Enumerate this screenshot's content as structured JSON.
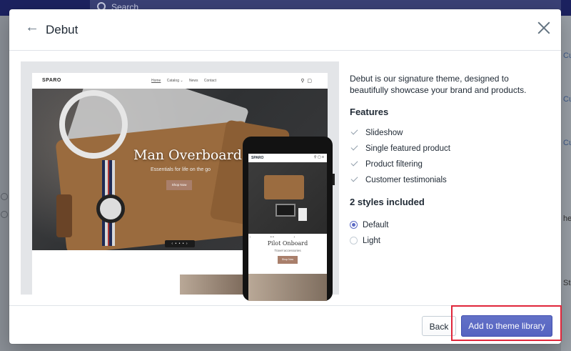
{
  "background": {
    "search_placeholder": "Search",
    "right_fragments": [
      "Cu",
      "Cu",
      "Cu",
      "he",
      "Sto"
    ]
  },
  "modal": {
    "title": "Debut",
    "description": "Debut is our signature theme, designed to beautifully showcase your brand and products.",
    "features_heading": "Features",
    "features": [
      "Slideshow",
      "Single featured product",
      "Product filtering",
      "Customer testimonials"
    ],
    "styles_heading": "2 styles included",
    "styles": [
      {
        "label": "Default",
        "selected": true
      },
      {
        "label": "Light",
        "selected": false
      }
    ],
    "footer": {
      "back_label": "Back",
      "add_label": "Add to theme library"
    }
  },
  "preview": {
    "site_logo": "SPARO",
    "nav_links": [
      "Home",
      "Catalog ⌄",
      "News",
      "Contact"
    ],
    "hero_title": "Man Overboard",
    "hero_subtitle": "Essentials for life on the go",
    "hero_button": "Shop Now",
    "phone_logo": "SPARO",
    "phone_title": "Pilot Onboard",
    "phone_subtitle": "Travel accessories",
    "phone_button": "Shop Now"
  },
  "colors": {
    "primary": "#5c6ac4",
    "highlight": "#e0263a",
    "text": "#212b36",
    "topbar": "#1c2260"
  }
}
